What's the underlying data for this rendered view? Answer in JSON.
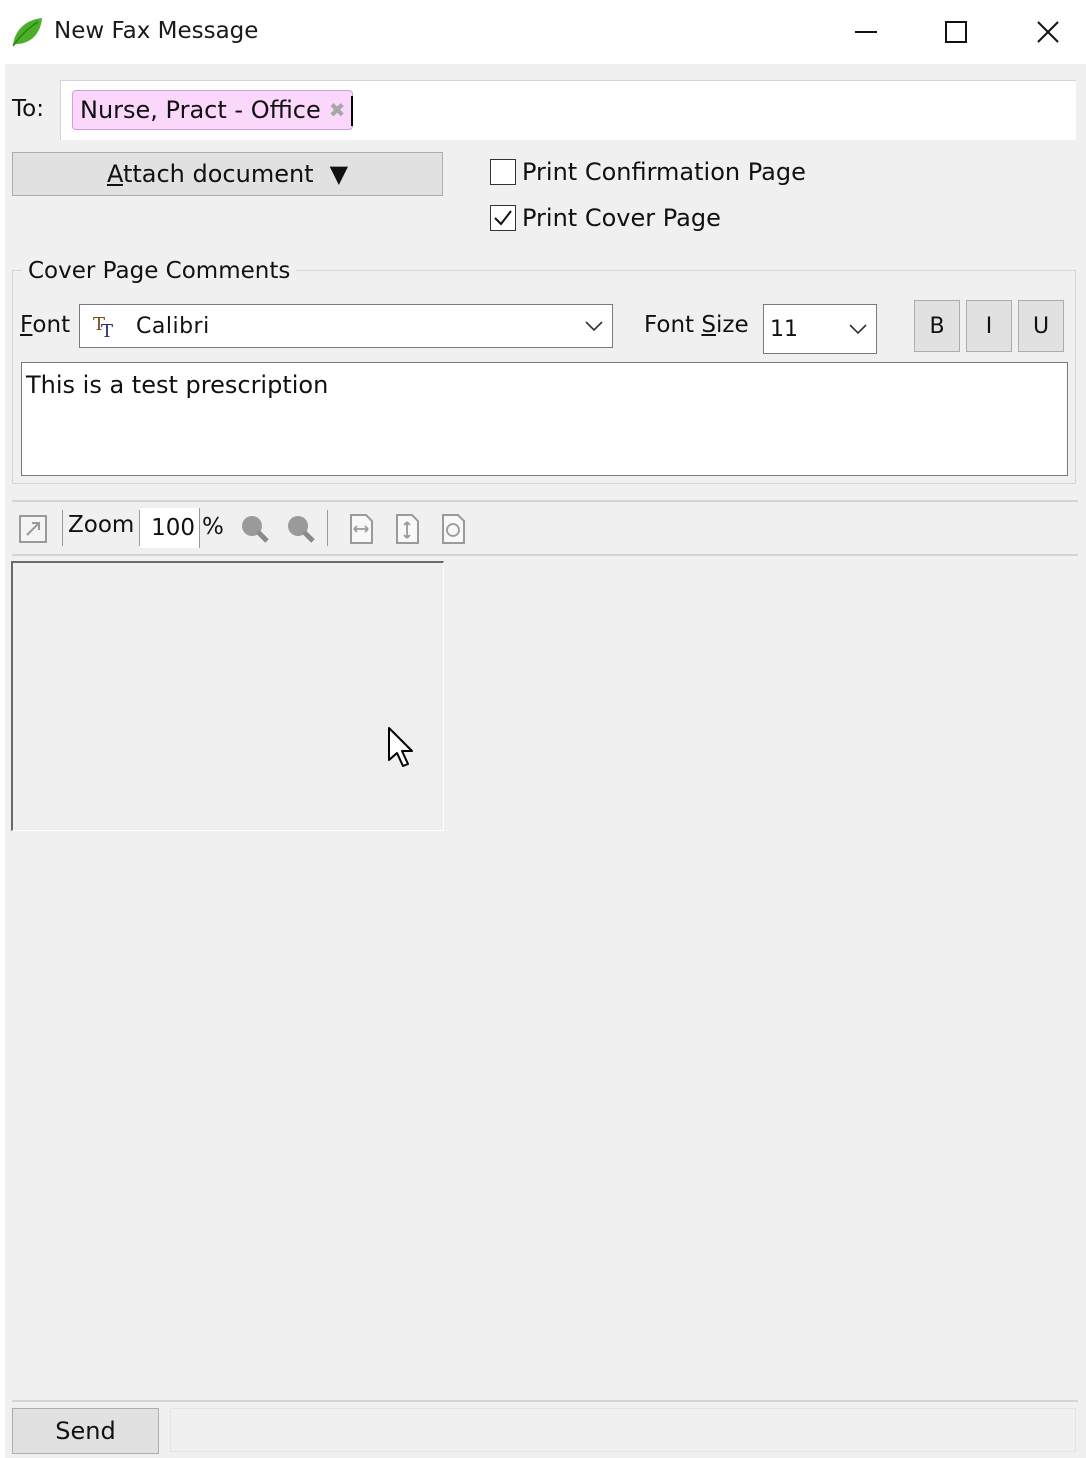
{
  "window": {
    "title": "New Fax Message",
    "app_icon": "green-leaf-icon",
    "controls": [
      "minimize-icon",
      "maximize-icon",
      "close-icon"
    ]
  },
  "recipients": {
    "label": "To:",
    "chips": [
      {
        "text": "Nurse, Pract - Office",
        "remove_glyph": "✖"
      }
    ]
  },
  "attach": {
    "label_first": "A",
    "label_rest": "ttach document",
    "arrow": "▼"
  },
  "options": {
    "print_confirmation": {
      "label": "Print Confirmation Page",
      "checked": false
    },
    "print_cover": {
      "label": "Print Cover Page",
      "checked": true
    }
  },
  "cover_page": {
    "group_title": "Cover Page Comments",
    "font_label_first": "F",
    "font_label_rest": "ont",
    "font_icon": "truetype-font-icon",
    "font_value": "Calibri",
    "size_label_pre": "Font ",
    "size_label_mn": "S",
    "size_label_post": "ize",
    "size_value": "11",
    "bold": "B",
    "italic": "I",
    "underline": "U",
    "comment_text": "This is a test prescription"
  },
  "preview_toolbar": {
    "zoom_label": "Zoom",
    "zoom_value": "100",
    "zoom_unit": "%",
    "icons": [
      "expand-icon",
      "zoom-in-icon",
      "zoom-out-icon",
      "fit-width-icon",
      "fit-height-icon",
      "fit-page-icon"
    ]
  },
  "footer": {
    "send_label": "Send"
  },
  "colors": {
    "chip_bg": "#fbd8fb",
    "chip_border": "#cf9fe0",
    "leaf_green": "#4caf2a",
    "window_bg": "#f0f0f0"
  }
}
